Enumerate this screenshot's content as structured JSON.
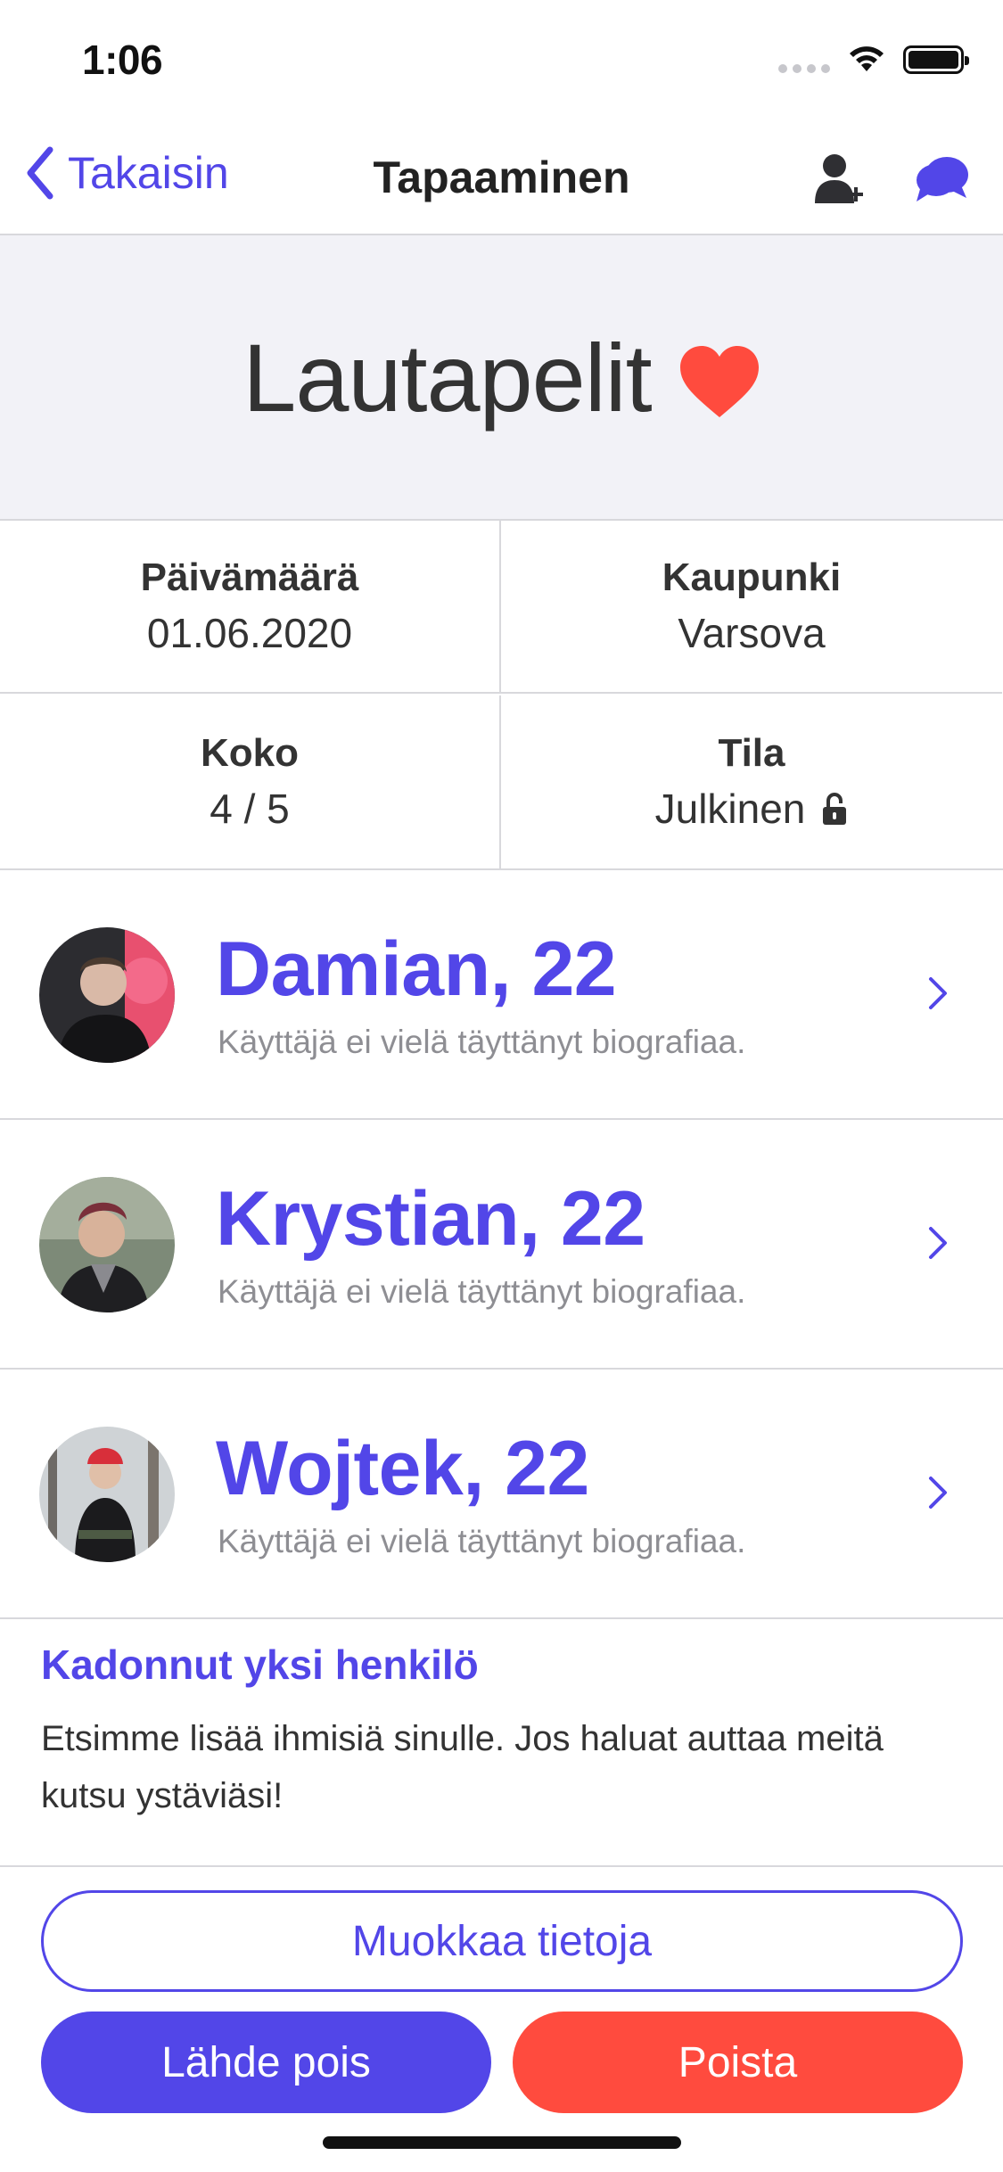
{
  "status_bar": {
    "time": "1:06"
  },
  "nav": {
    "back_label": "Takaisin",
    "title": "Tapaaminen",
    "icons": [
      "add-person-icon",
      "chat-icon"
    ]
  },
  "event": {
    "title": "Lautapelit",
    "heart_color": "#ff4b3e"
  },
  "info": {
    "date_label": "Päivämäärä",
    "date_value": "01.06.2020",
    "city_label": "Kaupunki",
    "city_value": "Varsova",
    "size_label": "Koko",
    "size_value": "4 / 5",
    "state_label": "Tila",
    "state_value": "Julkinen"
  },
  "members": [
    {
      "name": "Damian, 22",
      "bio": "Käyttäjä ei vielä täyttänyt biografiaa."
    },
    {
      "name": "Krystian, 22",
      "bio": "Käyttäjä ei vielä täyttänyt biografiaa."
    },
    {
      "name": "Wojtek, 22",
      "bio": "Käyttäjä ei vielä täyttänyt biografiaa."
    }
  ],
  "notice": {
    "title": "Kadonnut yksi henkilö",
    "text": "Etsimme lisää ihmisiä sinulle. Jos haluat auttaa meitä kutsu ystäviäsi!"
  },
  "buttons": {
    "edit": "Muokkaa tietoja",
    "leave": "Lähde pois",
    "delete": "Poista"
  },
  "colors": {
    "accent": "#5246e8",
    "danger": "#ff4b3e",
    "hero_background": "#f2f2f7"
  }
}
